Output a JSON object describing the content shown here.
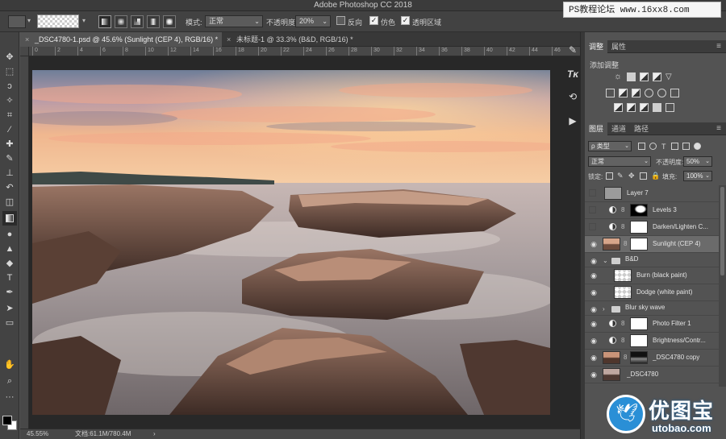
{
  "window": {
    "title": "Adobe Photoshop CC 2018"
  },
  "watermark_top": "PS教程论坛 www.16xx8.com",
  "options": {
    "mode_label": "模式:",
    "mode_value": "正常",
    "opacity_label": "不透明度:",
    "opacity_value": "20%",
    "reverse_label": "反向",
    "dither_label": "仿色",
    "transparency_label": "透明区域",
    "reverse_checked": false,
    "dither_checked": true,
    "transparency_checked": true
  },
  "tabs": [
    {
      "label": "_DSC4780-1.psd @ 45.6% (Sunlight (CEP 4), RGB/16) *",
      "active": true
    },
    {
      "label": "未标题-1 @ 33.3% (B&D, RGB/16) *",
      "active": false
    }
  ],
  "ruler": {
    "ticks": [
      "0",
      "2",
      "4",
      "6",
      "8",
      "10",
      "12",
      "14",
      "16",
      "18",
      "20",
      "22",
      "24",
      "26",
      "28",
      "30",
      "32",
      "34",
      "36",
      "38",
      "40",
      "42",
      "44",
      "46"
    ]
  },
  "status": {
    "zoom": "45.55%",
    "doc_info": "文档:61.1M/780.4M",
    "arrow": "›"
  },
  "tools": [
    "move",
    "marquee",
    "lasso",
    "magic-wand",
    "crop",
    "eyedropper",
    "healing",
    "brush",
    "stamp",
    "history-brush",
    "eraser",
    "gradient",
    "blur",
    "dodge",
    "pen",
    "type",
    "path-select",
    "shape",
    "hand",
    "zoom",
    "more"
  ],
  "panels": {
    "top_tabs": [
      "调整",
      "属性"
    ],
    "add_adjustment": "添加调整",
    "layer_tabs": [
      "图层",
      "通道",
      "路径"
    ],
    "filter_kind": "ρ 类型",
    "blend_mode": "正常",
    "opacity_label": "不透明度:",
    "opacity_value": "50%",
    "lock_label": "锁定:",
    "fill_label": "填充:",
    "fill_value": "100%"
  },
  "layers": [
    {
      "name": "Layer 7",
      "visible": false,
      "kind": "pixel",
      "thumb": "#9b9b9b"
    },
    {
      "name": "Levels 3",
      "visible": false,
      "kind": "adjust",
      "thumb": "mask-blob"
    },
    {
      "name": "Darken/Lighten C...",
      "visible": false,
      "kind": "adjust",
      "thumb": "white"
    },
    {
      "name": "Sunlight (CEP 4)",
      "visible": true,
      "kind": "smart",
      "thumb": "photo",
      "selected": true
    },
    {
      "name": "B&D",
      "visible": true,
      "kind": "group-open"
    },
    {
      "name": "Burn (black paint)",
      "visible": true,
      "kind": "checker",
      "indent": true
    },
    {
      "name": "Dodge (white paint)",
      "visible": true,
      "kind": "checker",
      "indent": true
    },
    {
      "name": "Blur sky wave",
      "visible": true,
      "kind": "group-closed"
    },
    {
      "name": "Photo Filter 1",
      "visible": true,
      "kind": "adjust",
      "thumb": "white"
    },
    {
      "name": "Brightness/Contr...",
      "visible": true,
      "kind": "adjust",
      "thumb": "white"
    },
    {
      "name": "_DSC4780 copy",
      "visible": true,
      "kind": "smart",
      "thumb": "photo2"
    },
    {
      "name": "_DSC4780",
      "visible": true,
      "kind": "pixel",
      "thumb": "photo3"
    }
  ],
  "logo": {
    "cn": "优图宝",
    "en": "utobao.com"
  }
}
